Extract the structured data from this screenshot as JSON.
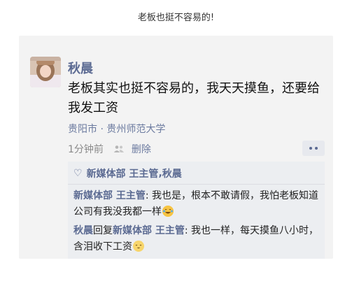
{
  "caption": "老板也挺不容易的!",
  "post": {
    "author": "秋晨",
    "text": "老板其实也挺不容易的，我天天摸鱼，还要给我发工资",
    "location": "贵阳市 · 贵州师范大学",
    "time": "1分钟前",
    "delete_label": "删除"
  },
  "feedback": {
    "likers": [
      "新媒体部 王主管",
      "秋晨"
    ],
    "liker_separator": ", ",
    "comments": [
      {
        "author": "新媒体部 王主管",
        "text": "我也是，根本不敢请假，我怕老板知道公司有我没我都一样"
      },
      {
        "author": "秋晨",
        "reply_word": "回复",
        "reply_to": "新媒体部 王主管",
        "text": "我也一样，每天摸鱼八小时，含泪收下工资"
      }
    ],
    "colon": ": "
  },
  "colors": {
    "name_blue": "#5b6a92",
    "card_bg": "#f3f3f3",
    "feedback_bg": "#eceef1"
  },
  "icons": [
    "avatar",
    "people-icon",
    "more-icon",
    "heart-icon",
    "laugh-emoji-icon",
    "cat-emoji-icon"
  ]
}
